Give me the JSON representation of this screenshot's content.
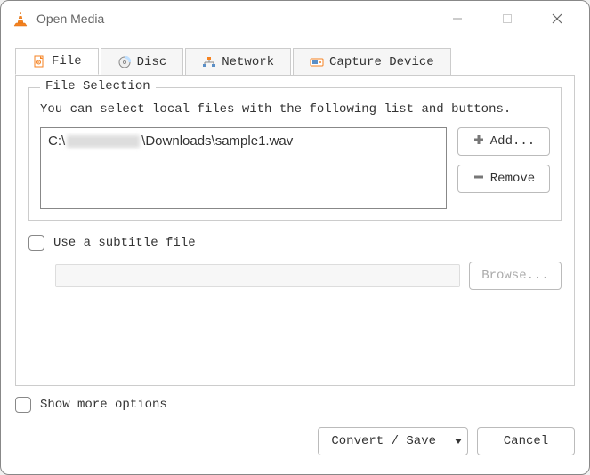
{
  "window": {
    "title": "Open Media"
  },
  "tabs": {
    "file": "File",
    "disc": "Disc",
    "network": "Network",
    "capture": "Capture Device"
  },
  "fileSection": {
    "legend": "File Selection",
    "hint": "You can select local files with the following list and buttons.",
    "entry_prefix": "C:\\",
    "entry_suffix": "\\Downloads\\sample1.wav",
    "addLabel": "Add...",
    "removeLabel": "Remove"
  },
  "subtitle": {
    "label": "Use a subtitle file",
    "browseLabel": "Browse..."
  },
  "moreOptions": "Show more options",
  "actions": {
    "convert": "Convert / Save",
    "cancel": "Cancel"
  }
}
